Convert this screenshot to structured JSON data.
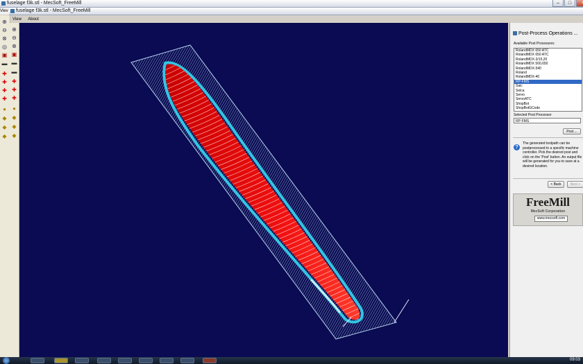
{
  "outer_window": {
    "title": "fuselage f3k.stl - MecSoft_FreeMill"
  },
  "inner_window": {
    "title": "fuselage f3k.stl - MecSoft_FreeMill"
  },
  "left_strip": {
    "label": "Viev"
  },
  "menu": {
    "items": [
      "View",
      "About"
    ]
  },
  "panel": {
    "title": "Post-Process Operations ...",
    "available_label": "Available Post Processors:",
    "processors": [
      "RolandMDX 650 ATC",
      "RolandMDX 650 ATC",
      "RolandMDX-3/15,20",
      "RolandMDX 500,650",
      "RolandMDX-540",
      "Roland",
      "RolandMDX-40",
      "RP-FMS",
      "Saic",
      "Selca",
      "Servo",
      "ServoATC",
      "ShopBot",
      "ShopBotGCode"
    ],
    "selected_index": 7,
    "selected_label": "Selected Post Processor",
    "selected_value": "RP-FMS",
    "post_button": "Post ...",
    "info_text": "The generated toolpath can be postprocessed to a specific machine controller. Pick the desired post and click on the 'Post' button. An output file will be generated for you to save at a desired location.",
    "back_button": "< Back",
    "next_button": "Next >"
  },
  "brand": {
    "title": "FreeMill",
    "subtitle": "MecSoft Corporation",
    "link": "www.mecsoft.com"
  },
  "taskbar": {
    "clock": "09:03"
  }
}
